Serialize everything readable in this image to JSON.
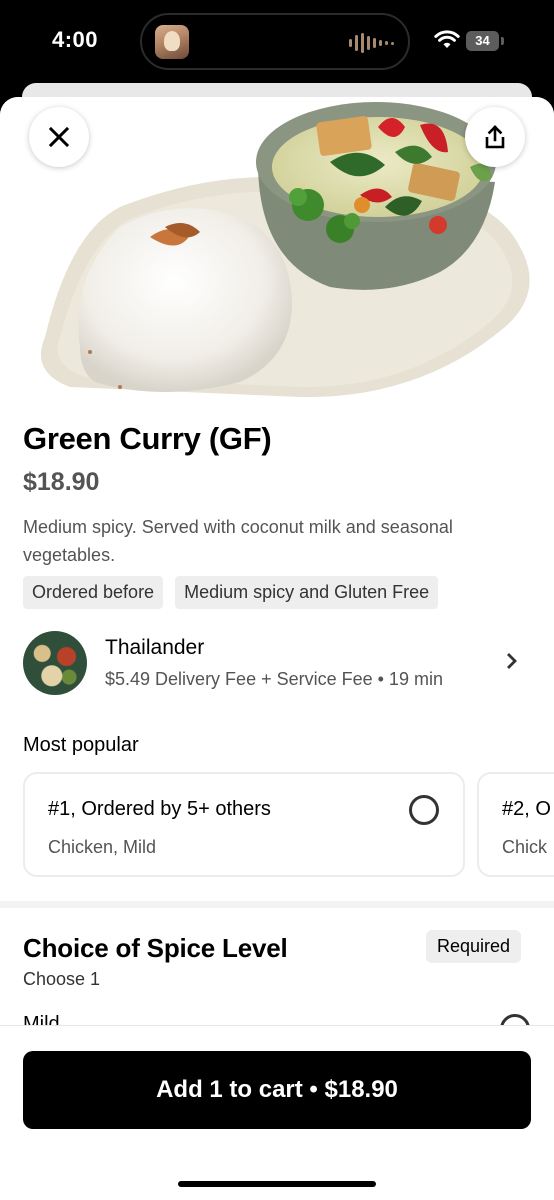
{
  "status_bar": {
    "time": "4:00",
    "battery": "34"
  },
  "item": {
    "title": "Green Curry (GF)",
    "price": "$18.90",
    "description": "Medium spicy.  Served with coconut milk and seasonal vegetables.",
    "tags": [
      "Ordered before",
      "Medium spicy and Gluten Free"
    ]
  },
  "store": {
    "name": "Thailander",
    "meta": "$5.49 Delivery Fee + Service Fee • 19 min"
  },
  "most_popular": {
    "label": "Most popular",
    "cards": [
      {
        "title": "#1, Ordered by 5+ others",
        "subtitle": "Chicken, Mild"
      },
      {
        "title": "#2, O",
        "subtitle": "Chick"
      }
    ]
  },
  "spice": {
    "title": "Choice of Spice Level",
    "subtitle": "Choose 1",
    "badge": "Required",
    "first_option": "Mild"
  },
  "cart": {
    "button_label": "Add 1 to cart • $18.90"
  },
  "colors": {
    "accent": "#000000",
    "secondary_text": "#545454",
    "chip_bg": "#eeeeee"
  }
}
